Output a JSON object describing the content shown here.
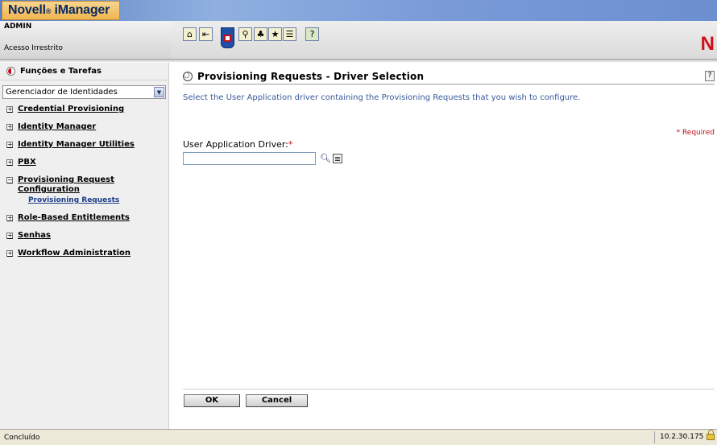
{
  "banner": {
    "logo": "Novell",
    "logo_reg": "®",
    "product": "iManager",
    "user_name": "ADMIN",
    "access": "Acesso Irrestrito",
    "brand_letter": "N",
    "toolbar_icons": [
      "home-icon",
      "exit-icon",
      "roles-tasks-icon",
      "view-objects-icon",
      "configure-icon",
      "favorites-icon",
      "preferences-icon",
      "help-icon"
    ]
  },
  "sidebar": {
    "header": "Funções e Tarefas",
    "selected_role": "Gerenciador de Identidades",
    "items": [
      {
        "label": "Credential Provisioning",
        "toggle": "+"
      },
      {
        "label": "Identity Manager",
        "toggle": "+"
      },
      {
        "label": "Identity Manager Utilities",
        "toggle": "+"
      },
      {
        "label": "PBX",
        "toggle": "+"
      },
      {
        "label": "Provisioning Request Configuration",
        "toggle": "−"
      },
      {
        "label": "Role-Based Entitlements",
        "toggle": "+"
      },
      {
        "label": "Senhas",
        "toggle": "+"
      },
      {
        "label": "Workflow Administration",
        "toggle": "+"
      }
    ],
    "sub_item": "Provisioning Requests"
  },
  "main": {
    "title": "Provisioning Requests - Driver Selection",
    "help": "?",
    "instruction": "Select the User Application driver containing the Provisioning Requests that you wish to configure.",
    "required_note": "* Required",
    "field_label": "User Application Driver:",
    "field_required_mark": "*",
    "field_value": "",
    "ok_label": "OK",
    "cancel_label": "Cancel"
  },
  "status": {
    "text": "Concluído",
    "ip": "10.2.30.175"
  },
  "colors": {
    "accent_red": "#c0101a",
    "link_blue": "#1b3c8a",
    "banner_blue": "#6c8fd0"
  }
}
